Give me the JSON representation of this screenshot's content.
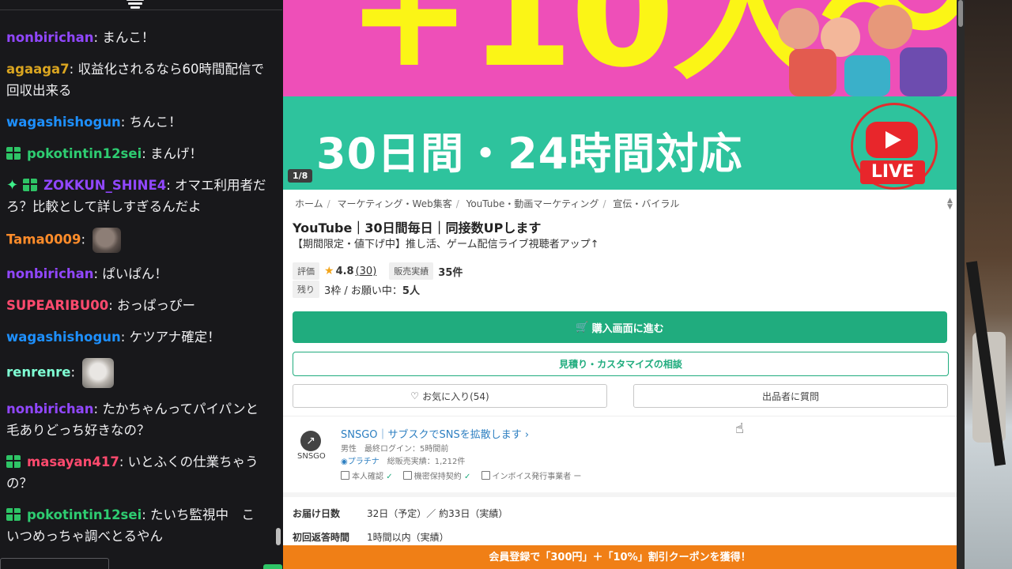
{
  "chat": {
    "messages": [
      {
        "user": "nonbirichan",
        "color": "#9147ff",
        "text": "まんこ！",
        "badges": []
      },
      {
        "user": "agaaga7",
        "color": "#daa520",
        "text": "収益化されるなら60時間配信で回収出来る",
        "badges": []
      },
      {
        "user": "wagashishogun",
        "color": "#1e90ff",
        "text": "ちんこ！",
        "badges": []
      },
      {
        "user": "pokotintin12sei",
        "color": "#2ecc71",
        "text": "まんげ！",
        "badges": [
          "gift"
        ]
      },
      {
        "user": "ZOKKUN_SHINE4",
        "color": "#9147ff",
        "text": "オマエ利用者だろ？比較として詳しすぎるんだよ",
        "badges": [
          "star",
          "gift"
        ]
      },
      {
        "user": "Tama0009",
        "color": "#ff8c2a",
        "text": "",
        "badges": [],
        "emote": "dog-emote"
      },
      {
        "user": "nonbirichan",
        "color": "#9147ff",
        "text": "ぱいぱん！",
        "badges": []
      },
      {
        "user": "SUPEARIBU00",
        "color": "#ff4a6e",
        "text": "おっぱっぴー",
        "badges": []
      },
      {
        "user": "wagashishogun",
        "color": "#1e90ff",
        "text": "ケツアナ確定！",
        "badges": []
      },
      {
        "user": "renrenre",
        "color": "#7fffd4",
        "text": "",
        "badges": [],
        "emote": "cat-emote"
      },
      {
        "user": "nonbirichan",
        "color": "#9147ff",
        "text": "たかちゃんってパイパンと毛ありどっち好きなの？",
        "badges": []
      },
      {
        "user": "masayan417",
        "color": "#ff4a6e",
        "text": "いとふくの仕業ちゃうの？",
        "badges": [
          "gift"
        ]
      },
      {
        "user": "pokotintin12sei",
        "color": "#2ecc71",
        "text": "たいち監視中　こいつめっちゃ調べとるやん",
        "badges": [
          "gift"
        ]
      }
    ]
  },
  "hero": {
    "big_text": "+10人〜",
    "sub_text": "30日間・24時間対応",
    "live_label": "LIVE",
    "counter": "1/8"
  },
  "breadcrumb": [
    "ホーム",
    "マーケティング・Web集客",
    "YouTube・動画マーケティング",
    "宣伝・バイラル"
  ],
  "product": {
    "title": "YouTube｜30日間毎日｜同接数UPします",
    "subtitle": "【期間限定・値下げ中】推し活、ゲーム配信ライブ視聴者アップ↑",
    "rating_label": "評価",
    "rating": "4.8",
    "rating_count": "(30)",
    "sales_label": "販売実績",
    "sales_value": "35件",
    "remain_label": "残り",
    "remain_value": "3枠 / お願い中：",
    "requests_value": "5人"
  },
  "buttons": {
    "buy": "購入画面に進む",
    "estimate": "見積り・カスタマイズの相談",
    "favorite": "お気に入り(54)",
    "ask": "出品者に質問"
  },
  "seller": {
    "logo_text": "SNSGO",
    "name": "SNSGO｜サブスクでSNSを拡散します",
    "meta1": "男性　最終ログイン：5時間前",
    "rank": "プラチナ",
    "total_sales": "　総販売実績：1,212件",
    "verify": "本人確認",
    "nda": "機密保持契約",
    "invoice": "インボイス発行事業者 ー"
  },
  "delivery": {
    "label1": "お届け日数",
    "value1": "32日（予定）／ 約33日（実績）",
    "label2": "初回返答時間",
    "value2": "1時間以内（実績）"
  },
  "banner": {
    "text": "会員登録で「300円」＋「10%」割引クーポンを獲得！"
  },
  "colors": {
    "accent_green": "#20ac7e",
    "hero_pink": "#ee4fb8",
    "hero_green": "#2ec39d",
    "hero_yellow": "#fbf516",
    "banner_orange": "#f07f16"
  }
}
